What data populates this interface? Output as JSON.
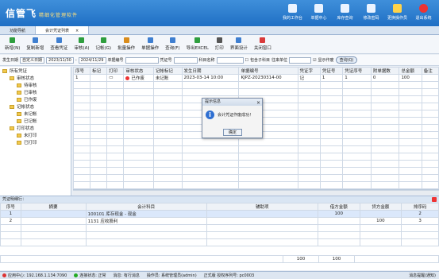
{
  "app": {
    "brand": "信管飞",
    "subtitle": "精细化管理软件"
  },
  "top_nav": [
    {
      "label": "我的工作台",
      "icon": "monitor-icon"
    },
    {
      "label": "单据中心",
      "icon": "document-icon"
    },
    {
      "label": "库存查询",
      "icon": "box-icon"
    },
    {
      "label": "修改密码",
      "icon": "lock-icon"
    },
    {
      "label": "更换操作员",
      "icon": "user-icon"
    },
    {
      "label": "退出系统",
      "icon": "exit-icon"
    }
  ],
  "tabs": [
    {
      "label": "功能导航",
      "active": false
    },
    {
      "label": "会计凭证列表",
      "active": true,
      "close": "×"
    }
  ],
  "toolbar": [
    {
      "label": "新增(N)",
      "icon": "add-icon",
      "color": "#2e9e3e"
    },
    {
      "label": "复制新增",
      "icon": "copy-icon",
      "color": "#3f7fd0"
    },
    {
      "label": "查看凭证",
      "icon": "view-icon",
      "color": "#3f7fd0"
    },
    {
      "label": "审核(A)",
      "icon": "audit-icon",
      "color": "#2e9e3e"
    },
    {
      "label": "记帐(G)",
      "icon": "post-icon",
      "color": "#2e9e3e"
    },
    {
      "label": "批量操作",
      "icon": "batch-icon",
      "color": "#d98c1c"
    },
    {
      "label": "单据操作",
      "icon": "bill-icon",
      "color": "#3f7fd0"
    },
    {
      "label": "查询(F)",
      "icon": "search-icon",
      "color": "#3f7fd0"
    },
    {
      "label": "导出EXCEL",
      "icon": "excel-icon",
      "color": "#2e9e3e"
    },
    {
      "label": "打印",
      "icon": "print-icon",
      "color": "#555555"
    },
    {
      "label": "界面设计",
      "icon": "design-icon",
      "color": "#3f7fd0"
    },
    {
      "label": "关闭窗口",
      "icon": "close-icon",
      "color": "#d93a3a"
    }
  ],
  "filter": {
    "date_label": "发生日期",
    "range_value": "自定义日期",
    "date_from": "2023/11/30",
    "date_to": "2024/11/29",
    "bill_no_label": "单据编号",
    "voucher_word_label": "凭证号",
    "subject_label": "科目名称",
    "include_sub_label": "包含子科目",
    "entity_label": "往来单位",
    "show_voided_label": "显示作废",
    "query_button": "查询(Q)"
  },
  "tree": [
    {
      "label": "所有凭证",
      "level": 0
    },
    {
      "label": "审核状态",
      "level": 1
    },
    {
      "label": "待审核",
      "level": 2
    },
    {
      "label": "已审核",
      "level": 2
    },
    {
      "label": "已作废",
      "level": 2
    },
    {
      "label": "记帐状态",
      "level": 1
    },
    {
      "label": "未记帐",
      "level": 2
    },
    {
      "label": "已记帐",
      "level": 2
    },
    {
      "label": "打印状态",
      "level": 1
    },
    {
      "label": "未打印",
      "level": 2
    },
    {
      "label": "已打印",
      "level": 2
    }
  ],
  "grid": {
    "columns": [
      "序号",
      "标记",
      "打印",
      "审核状态",
      "记帐标记",
      "发生日期",
      "单据编号",
      "凭证字",
      "凭证号",
      "凭证序号",
      "附单据数",
      "总金额",
      "备注"
    ],
    "rows": [
      {
        "no": "1",
        "mark": "",
        "print": "",
        "audit": "已作废",
        "post": "未记账",
        "date": "2023-03-14 10:00",
        "bill": "KJPZ-20230314-00",
        "word": "记",
        "num": "1",
        "seq": "1",
        "attach": "0",
        "amount": "100",
        "note": ""
      }
    ]
  },
  "detail": {
    "title": "凭证明细行：",
    "columns": [
      "序号",
      "摘要",
      "会计科目",
      "辅助项",
      "借方金额",
      "贷方金额",
      "排序码"
    ],
    "rows": [
      {
        "no": "1",
        "summary": "",
        "subject": "100101 库存现金 - 现金",
        "aux": "",
        "debit": "100",
        "credit": "",
        "sort": "2"
      },
      {
        "no": "2",
        "summary": "",
        "subject": "1131 应收股利",
        "aux": "",
        "debit": "",
        "credit": "100",
        "sort": "3"
      }
    ],
    "totals": {
      "debit": "100",
      "credit": "100"
    }
  },
  "dialog": {
    "title": "提示信息",
    "message": "会计凭证作废成功！",
    "ok": "确定"
  },
  "status": {
    "server": "应用中心: 192.168.1.134:7090",
    "conn": "连接状态: 正常",
    "msg": "消息: 有行消息",
    "user": "操作员: 系统管理员(admin)",
    "license": "正式版 授权序列号: pc0003",
    "notify": "消息提醒(通知)"
  }
}
